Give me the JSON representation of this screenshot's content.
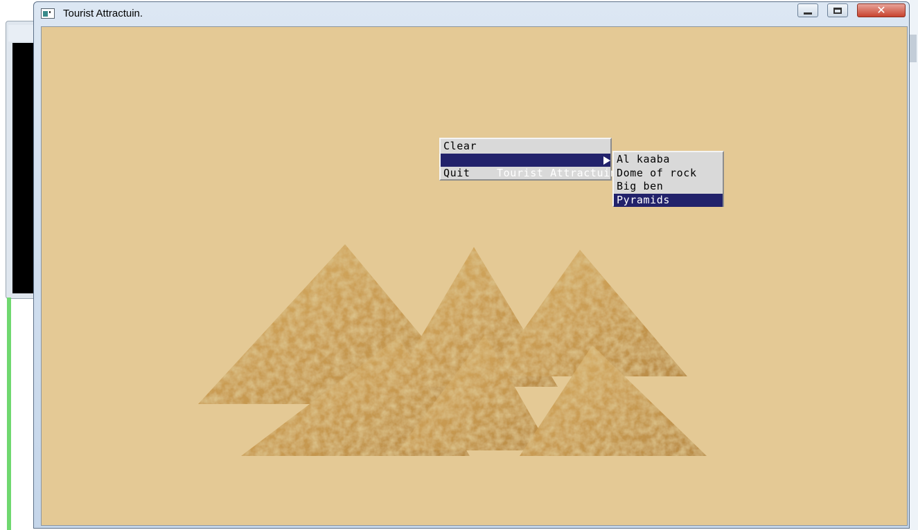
{
  "window": {
    "title": "Tourist Attractuin.",
    "close_glyph": "✕"
  },
  "menu": {
    "items": [
      {
        "label": "Clear"
      },
      {
        "label": "Tourist Attractuin"
      },
      {
        "label": "Quit"
      }
    ],
    "active_index": 1
  },
  "submenu": {
    "items": [
      {
        "label": "Al kaaba"
      },
      {
        "label": "Dome of rock"
      },
      {
        "label": "Big ben"
      },
      {
        "label": "Pyramids"
      }
    ],
    "active_index": 3
  },
  "colors": {
    "canvas_background": "#e4c995",
    "menu_background": "#d9d9d9",
    "menu_highlight": "#22226b",
    "sand_base": "#c9a15a"
  },
  "icons": {
    "app": "app-window-icon",
    "minimize": "minimize-icon",
    "maximize": "maximize-icon",
    "close": "close-icon",
    "submenu": "submenu-arrow-icon"
  }
}
